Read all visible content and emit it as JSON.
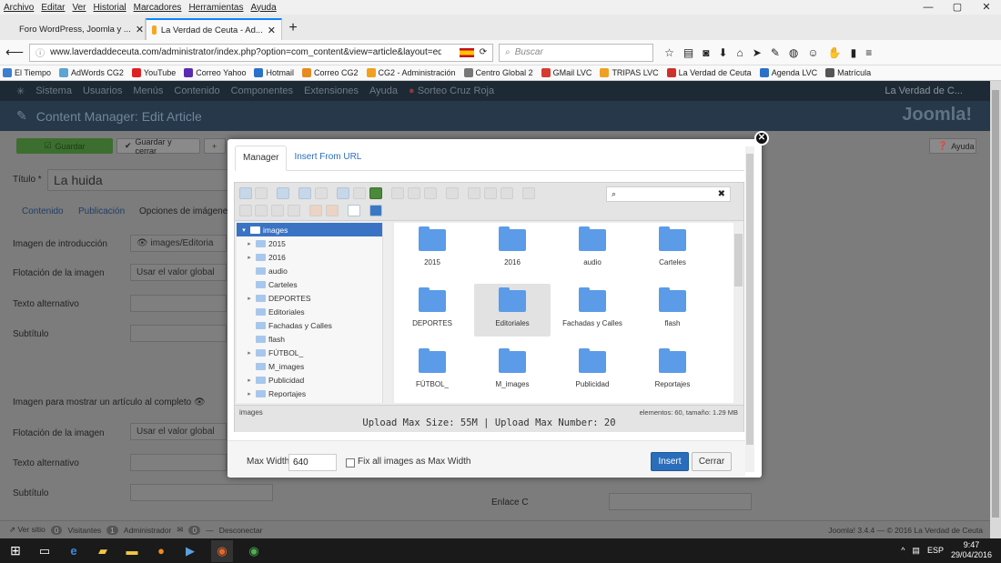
{
  "menu": [
    "Archivo",
    "Editar",
    "Ver",
    "Historial",
    "Marcadores",
    "Herramientas",
    "Ayuda"
  ],
  "window_controls": [
    "—",
    "▢",
    "✕"
  ],
  "tabs": [
    {
      "label": "Foro WordPress, Joomla y ...",
      "icon_color": "#e2322d"
    },
    {
      "label": "La Verdad de Ceuta - Ad...",
      "icon_color": "#f5a623"
    }
  ],
  "url": "www.laverdaddeceuta.com/administrator/index.php?option=com_content&view=article&layout=edit&ic",
  "search_placeholder": "Buscar",
  "bookmarks": [
    {
      "label": "El Tiempo",
      "color": "#3a7fd0"
    },
    {
      "label": "AdWords CG2",
      "color": "#5aa4d6"
    },
    {
      "label": "YouTube",
      "color": "#e02020"
    },
    {
      "label": "Correo Yahoo",
      "color": "#5a2bb0"
    },
    {
      "label": "Hotmail",
      "color": "#2a70c9"
    },
    {
      "label": "Correo CG2",
      "color": "#e88a20"
    },
    {
      "label": "CG2 - Administración",
      "color": "#f2a020"
    },
    {
      "label": "Centro Global 2",
      "color": "#777777"
    },
    {
      "label": "GMail LVC",
      "color": "#d63b30"
    },
    {
      "label": "TRIPAS LVC",
      "color": "#f0a020"
    },
    {
      "label": "La Verdad de Ceuta",
      "color": "#d0302a"
    },
    {
      "label": "Agenda LVC",
      "color": "#2a70c9"
    },
    {
      "label": "Matrícula",
      "color": "#555555"
    }
  ],
  "joomla": {
    "topmenu": [
      "Sistema",
      "Usuarios",
      "Menús",
      "Contenido",
      "Componentes",
      "Extensiones",
      "Ayuda",
      "Sorteo Cruz Roja"
    ],
    "site_name": "La Verdad de C...",
    "header_title": "Content Manager: Edit Article",
    "logo": "Joomla!",
    "btn_save": "Guardar",
    "btn_save_close": "Guardar y cerrar",
    "btn_help": "Ayuda",
    "title_label": "Título *",
    "title_value": "La huida",
    "subtabs": [
      "Contenido",
      "Publicación",
      "Opciones de imágenes"
    ],
    "fields": {
      "intro_image": "Imagen de introducción",
      "intro_image_value": "images/Editoria",
      "float1": "Flotación de la imagen",
      "float_value": "Usar el valor global",
      "alt1": "Texto alternativo",
      "sub1": "Subtítulo",
      "full_image": "Imagen para mostrar un artículo al completo",
      "float2": "Flotación de la imagen",
      "alt2": "Texto alternativo",
      "sub2": "Subtítulo",
      "link_c": "Enlace C"
    },
    "status_left": "Ver sitio",
    "visitors": "0",
    "visitors_label": "Visitantes",
    "admins": "1",
    "admins_label": "Administrador",
    "messages": "0",
    "logout": "Desconectar",
    "status_right": "Joomla! 3.4.4 — © 2016 La Verdad de Ceuta"
  },
  "modal": {
    "tabs": [
      "Manager",
      "Insert From URL"
    ],
    "tree": [
      {
        "label": "images",
        "selected": true,
        "expandable": true
      },
      {
        "label": "2015",
        "expandable": true
      },
      {
        "label": "2016",
        "expandable": true
      },
      {
        "label": "audio",
        "expandable": false
      },
      {
        "label": "Carteles",
        "expandable": false
      },
      {
        "label": "DEPORTES",
        "expandable": true
      },
      {
        "label": "Editoriales",
        "expandable": false
      },
      {
        "label": "Fachadas y Calles",
        "expandable": false
      },
      {
        "label": "flash",
        "expandable": false
      },
      {
        "label": "FÚTBOL_",
        "expandable": true
      },
      {
        "label": "M_images",
        "expandable": false
      },
      {
        "label": "Publicidad",
        "expandable": true
      },
      {
        "label": "Reportajes",
        "expandable": true
      }
    ],
    "folders": [
      "2015",
      "2016",
      "audio",
      "Carteles",
      "DEPORTES",
      "Editoriales",
      "Fachadas y Calles",
      "flash",
      "FÚTBOL_",
      "M_images",
      "Publicidad",
      "Reportajes"
    ],
    "selected_folder": "Editoriales",
    "path": "images",
    "count": "elementos: 60, tamaño: 1.29 MB",
    "upload_info": "Upload Max Size: 55M | Upload Max Number: 20",
    "max_width_label": "Max Width",
    "max_width_value": "640",
    "fix_label": "Fix all images as Max Width",
    "insert": "Insert",
    "close": "Cerrar"
  },
  "taskbar": {
    "lang": "ESP",
    "time": "9:47",
    "date": "29/04/2016"
  }
}
